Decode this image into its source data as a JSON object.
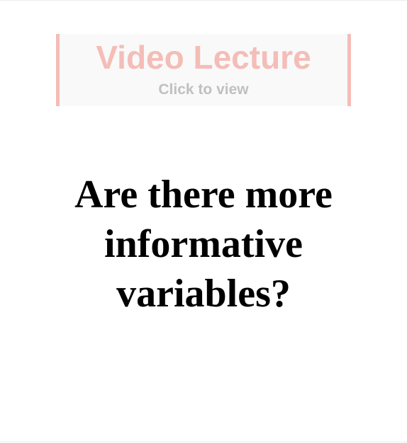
{
  "video_banner": {
    "title": "Video Lecture",
    "subtitle": "Click to view"
  },
  "slide": {
    "heading": "Are there more informative variables?"
  },
  "colors": {
    "banner_accent": "#f4bdb7",
    "banner_background": "#f9f9f9",
    "subtitle_text": "#c0c0c0",
    "heading_text": "#000000"
  }
}
